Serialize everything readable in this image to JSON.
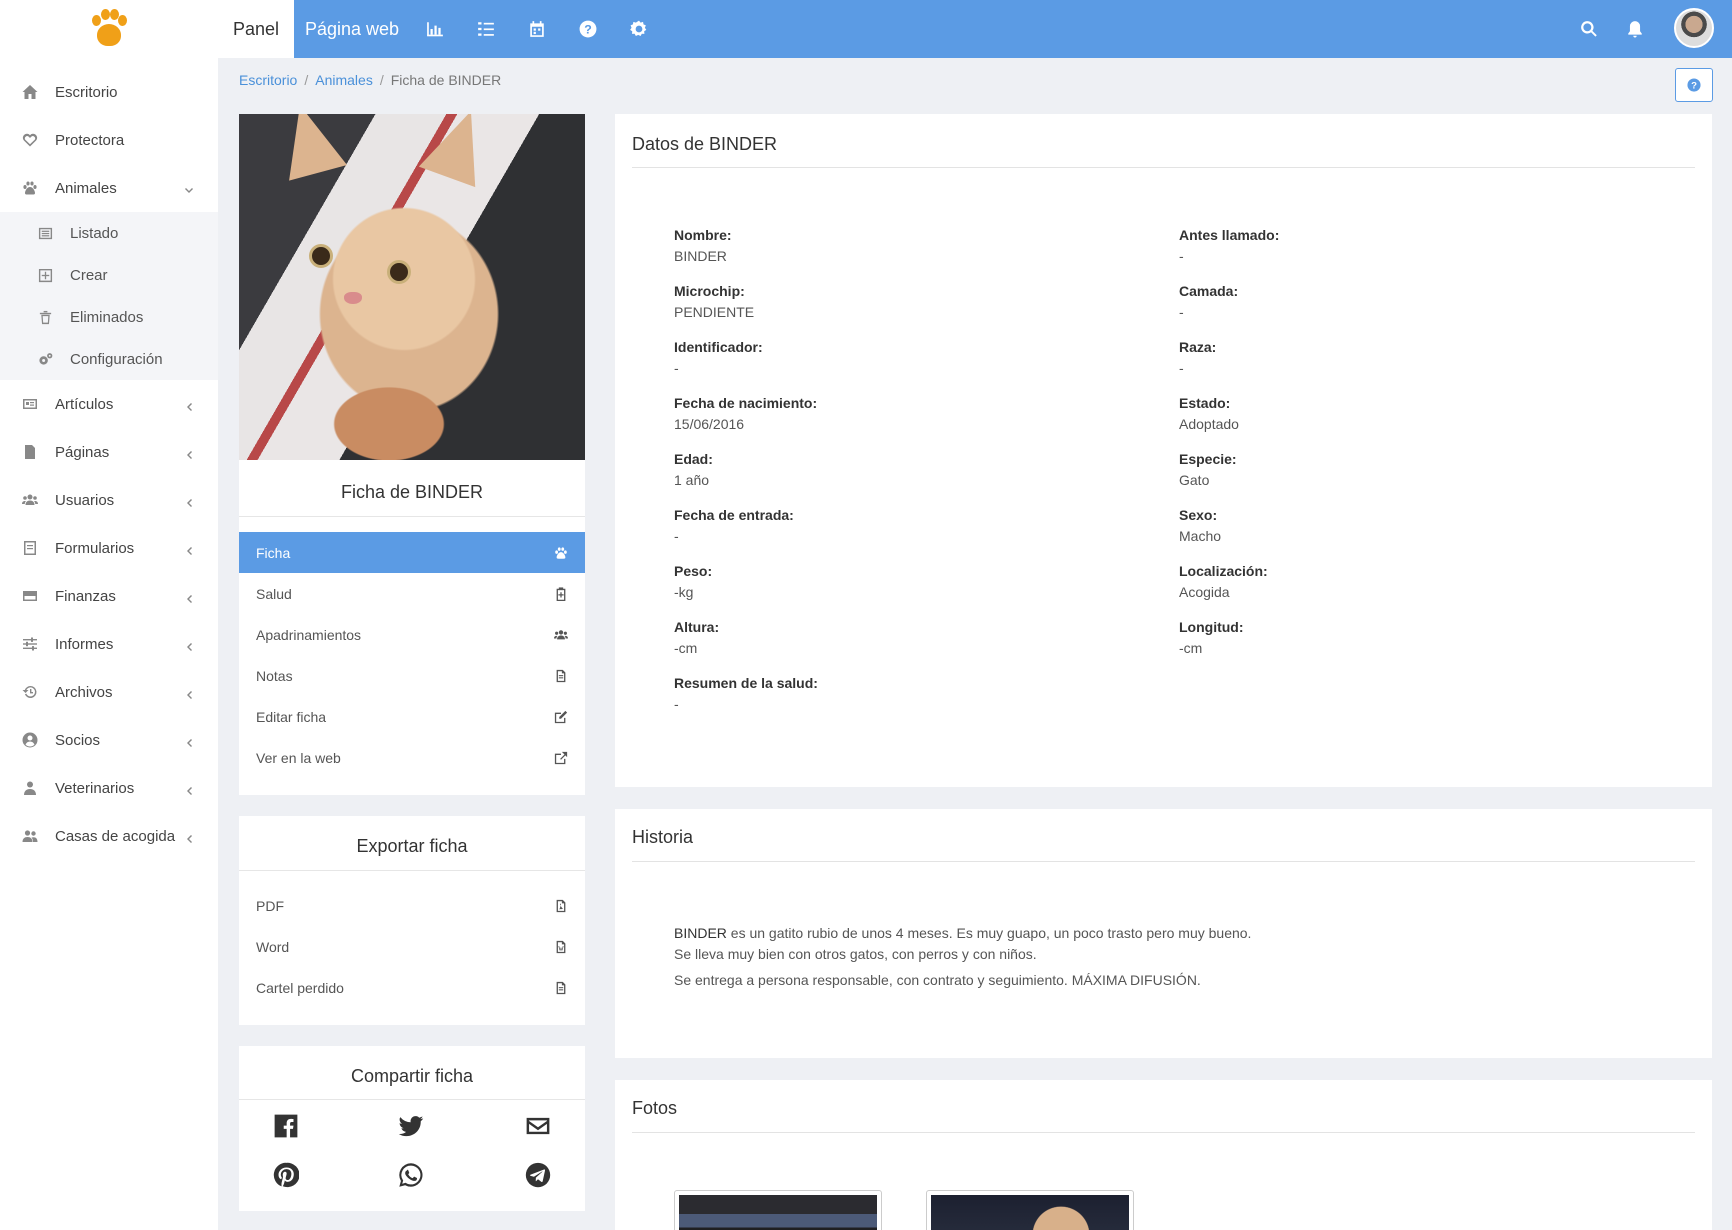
{
  "topbar": {
    "tabs": [
      {
        "label": "Panel"
      },
      {
        "label": "Página web"
      }
    ],
    "icons": [
      "bar-chart-icon",
      "tasks-icon",
      "calendar-icon",
      "question-circle-icon",
      "gear-icon",
      "search-icon",
      "bell-icon"
    ]
  },
  "sidebar": {
    "items": [
      {
        "label": "Escritorio",
        "icon": "home-icon"
      },
      {
        "label": "Protectora",
        "icon": "heart-icon"
      },
      {
        "label": "Animales",
        "icon": "paw-icon",
        "expanded": true
      },
      {
        "label": "Artículos",
        "icon": "newspaper-icon"
      },
      {
        "label": "Páginas",
        "icon": "file-icon"
      },
      {
        "label": "Usuarios",
        "icon": "users-icon"
      },
      {
        "label": "Formularios",
        "icon": "form-icon"
      },
      {
        "label": "Finanzas",
        "icon": "credit-card-icon"
      },
      {
        "label": "Informes",
        "icon": "sliders-icon"
      },
      {
        "label": "Archivos",
        "icon": "history-icon"
      },
      {
        "label": "Socios",
        "icon": "user-circle-icon"
      },
      {
        "label": "Veterinarios",
        "icon": "user-md-icon"
      },
      {
        "label": "Casas de acogida",
        "icon": "users-icon"
      }
    ],
    "subitems": [
      {
        "label": "Listado",
        "icon": "list-icon"
      },
      {
        "label": "Crear",
        "icon": "plus-square-icon"
      },
      {
        "label": "Eliminados",
        "icon": "trash-icon"
      },
      {
        "label": "Configuración",
        "icon": "cogs-icon"
      }
    ]
  },
  "breadcrumb": {
    "items": [
      "Escritorio",
      "Animales",
      "Ficha de BINDER"
    ],
    "separator": "/"
  },
  "animal_card": {
    "title": "Ficha de BINDER",
    "menu": [
      {
        "label": "Ficha",
        "icon": "paw-icon",
        "active": true
      },
      {
        "label": "Salud",
        "icon": "clipboard-icon"
      },
      {
        "label": "Apadrinamientos",
        "icon": "users-icon"
      },
      {
        "label": "Notas",
        "icon": "file-text-icon"
      },
      {
        "label": "Editar ficha",
        "icon": "edit-icon"
      },
      {
        "label": "Ver en la web",
        "icon": "external-link-icon"
      }
    ]
  },
  "export_card": {
    "title": "Exportar ficha",
    "items": [
      {
        "label": "PDF",
        "icon": "file-pdf-icon"
      },
      {
        "label": "Word",
        "icon": "file-word-icon"
      },
      {
        "label": "Cartel perdido",
        "icon": "file-text-icon"
      }
    ]
  },
  "share_card": {
    "title": "Compartir ficha",
    "icons": [
      "facebook-icon",
      "twitter-icon",
      "envelope-icon",
      "pinterest-icon",
      "whatsapp-icon",
      "telegram-icon"
    ]
  },
  "datos": {
    "title": "Datos de BINDER",
    "left": [
      {
        "label": "Nombre:",
        "value": "BINDER"
      },
      {
        "label": "Microchip:",
        "value": "PENDIENTE"
      },
      {
        "label": "Identificador:",
        "value": "-"
      },
      {
        "label": "Fecha de nacimiento:",
        "value": "15/06/2016"
      },
      {
        "label": "Edad:",
        "value": "1 año"
      },
      {
        "label": "Fecha de entrada:",
        "value": "-"
      },
      {
        "label": "Peso:",
        "value": "-kg"
      },
      {
        "label": "Altura:",
        "value": "-cm"
      },
      {
        "label": "Resumen de la salud:",
        "value": "-"
      }
    ],
    "right": [
      {
        "label": "Antes llamado:",
        "value": "-"
      },
      {
        "label": "Camada:",
        "value": "-"
      },
      {
        "label": "Raza:",
        "value": "-"
      },
      {
        "label": "Estado:",
        "value": "Adoptado"
      },
      {
        "label": "Especie:",
        "value": "Gato"
      },
      {
        "label": "Sexo:",
        "value": "Macho"
      },
      {
        "label": "Localización:",
        "value": "Acogida"
      },
      {
        "label": "Longitud:",
        "value": "-cm"
      }
    ]
  },
  "historia": {
    "title": "Historia",
    "name": "BINDER",
    "line1_rest": " es un gatito rubio de unos 4 meses. Es muy guapo, un poco trasto pero muy bueno.",
    "line2": "Se lleva muy bien con otros gatos, con perros y con niños.",
    "line3": "Se entrega a persona responsable, con contrato y seguimiento. MÁXIMA DIFUSIÓN."
  },
  "fotos": {
    "title": "Fotos"
  },
  "colors": {
    "primary": "#5b9be4",
    "background": "#eef0f4",
    "logo": "#f0a018"
  }
}
